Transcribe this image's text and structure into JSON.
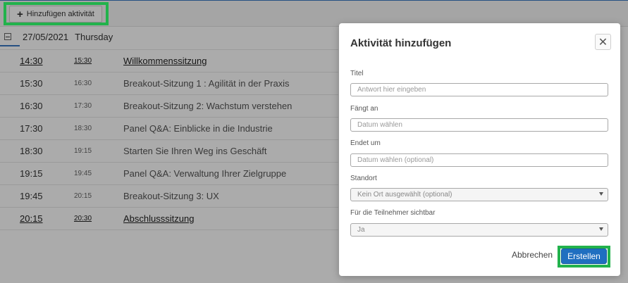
{
  "toolbar": {
    "add_label": "Hinzufügen aktivität"
  },
  "day": {
    "date": "27/05/2021",
    "weekday": "Thursday"
  },
  "sessions": [
    {
      "start": "14:30",
      "end": "15:30",
      "title": "Willkommenssitzung",
      "linked": true
    },
    {
      "start": "15:30",
      "end": "16:30",
      "title": "Breakout-Sitzung 1 : Agilität in der Praxis",
      "linked": false
    },
    {
      "start": "16:30",
      "end": "17:30",
      "title": "Breakout-Sitzung 2: Wachstum verstehen",
      "linked": false
    },
    {
      "start": "17:30",
      "end": "18:30",
      "title": "Panel Q&A: Einblicke in die Industrie",
      "linked": false
    },
    {
      "start": "18:30",
      "end": "19:15",
      "title": "Starten Sie Ihren Weg ins Geschäft",
      "linked": false
    },
    {
      "start": "19:15",
      "end": "19:45",
      "title": "Panel Q&A: Verwaltung Ihrer Zielgruppe",
      "linked": false
    },
    {
      "start": "19:45",
      "end": "20:15",
      "title": "Breakout-Sitzung 3: UX",
      "linked": false
    },
    {
      "start": "20:15",
      "end": "20:30",
      "title": "Abschlusssitzung",
      "linked": true
    }
  ],
  "modal": {
    "title": "Aktivität hinzufügen",
    "close_icon": "close-icon",
    "fields": {
      "titel": {
        "label": "Titel",
        "placeholder": "Antwort hier eingeben"
      },
      "start": {
        "label": "Fängt an",
        "placeholder": "Datum wählen"
      },
      "end": {
        "label": "Endet um",
        "placeholder": "Datum wählen (optional)"
      },
      "location": {
        "label": "Standort",
        "value": "Kein Ort ausgewählt (optional)"
      },
      "visible": {
        "label": "Für die Teilnehmer sichtbar",
        "value": "Ja"
      }
    },
    "cancel_label": "Abbrechen",
    "create_label": "Erstellen"
  },
  "colors": {
    "accent": "#1f6fc0",
    "highlight": "#22b24c",
    "overlay": "rgba(0,0,0,0.33)"
  }
}
